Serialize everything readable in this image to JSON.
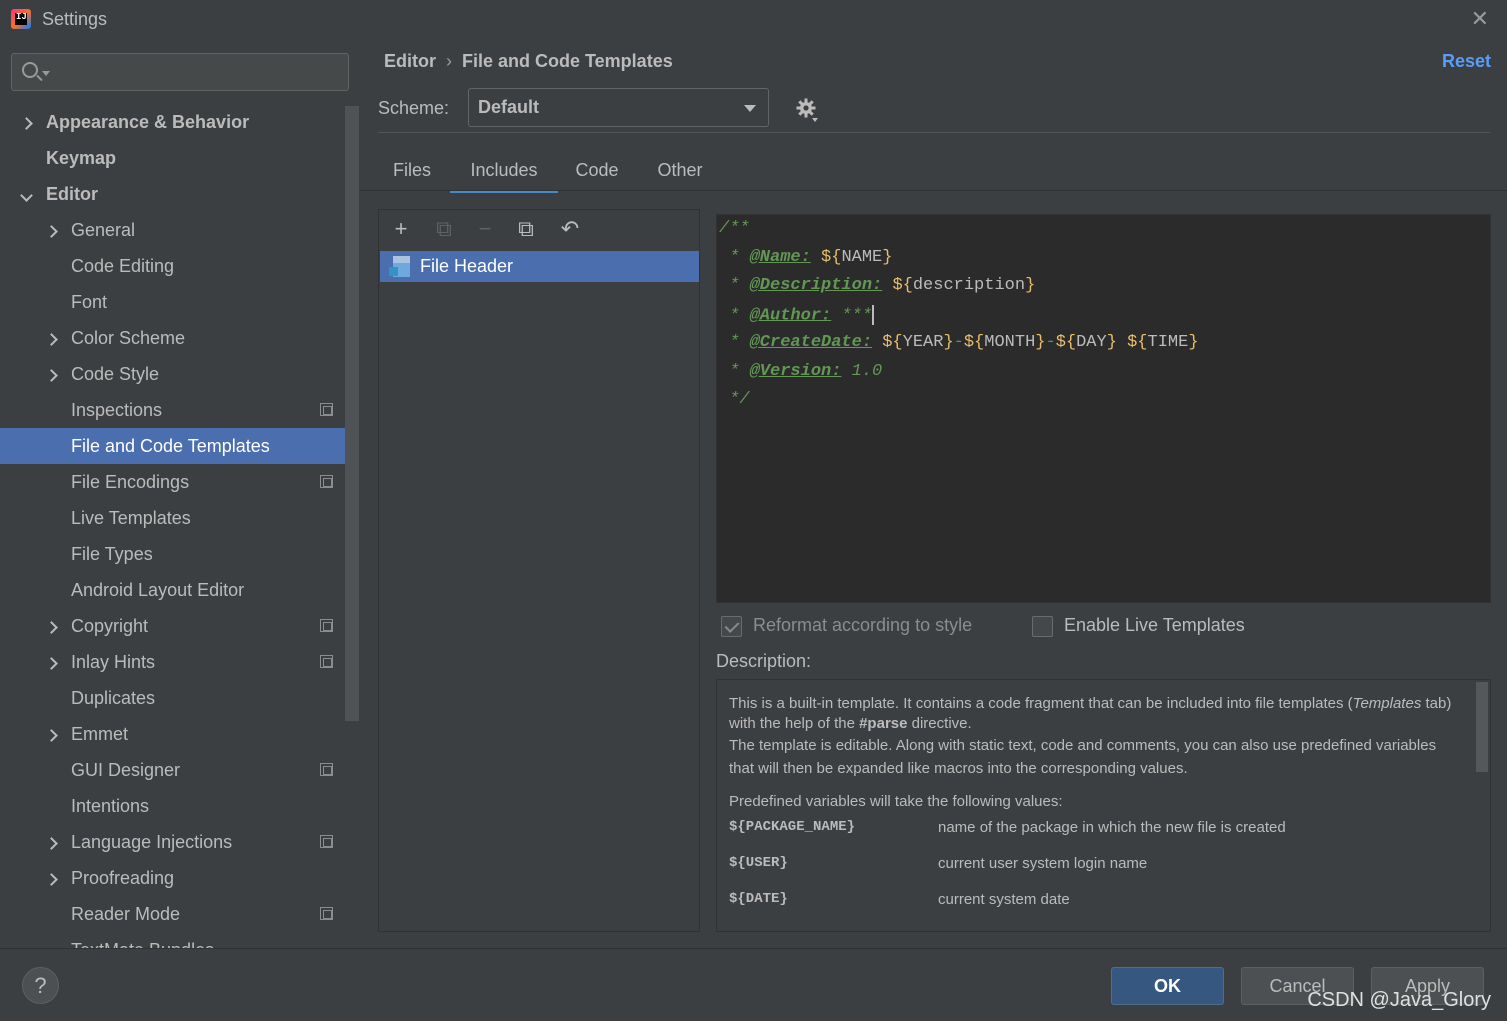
{
  "window": {
    "title": "Settings",
    "close_icon": "close-icon"
  },
  "sidebar": {
    "search_placeholder": "",
    "items": [
      {
        "label": "Appearance & Behavior",
        "level": 0,
        "arrow": "right",
        "project_icon": false,
        "selected": false
      },
      {
        "label": "Keymap",
        "level": 0,
        "arrow": "none",
        "project_icon": false,
        "selected": false
      },
      {
        "label": "Editor",
        "level": 0,
        "arrow": "down",
        "project_icon": false,
        "selected": false
      },
      {
        "label": "General",
        "level": 1,
        "arrow": "right",
        "project_icon": false,
        "selected": false
      },
      {
        "label": "Code Editing",
        "level": 1,
        "arrow": "none",
        "project_icon": false,
        "selected": false
      },
      {
        "label": "Font",
        "level": 1,
        "arrow": "none",
        "project_icon": false,
        "selected": false
      },
      {
        "label": "Color Scheme",
        "level": 1,
        "arrow": "right",
        "project_icon": false,
        "selected": false
      },
      {
        "label": "Code Style",
        "level": 1,
        "arrow": "right",
        "project_icon": false,
        "selected": false
      },
      {
        "label": "Inspections",
        "level": 1,
        "arrow": "none",
        "project_icon": true,
        "selected": false
      },
      {
        "label": "File and Code Templates",
        "level": 1,
        "arrow": "none",
        "project_icon": false,
        "selected": true
      },
      {
        "label": "File Encodings",
        "level": 1,
        "arrow": "none",
        "project_icon": true,
        "selected": false
      },
      {
        "label": "Live Templates",
        "level": 1,
        "arrow": "none",
        "project_icon": false,
        "selected": false
      },
      {
        "label": "File Types",
        "level": 1,
        "arrow": "none",
        "project_icon": false,
        "selected": false
      },
      {
        "label": "Android Layout Editor",
        "level": 1,
        "arrow": "none",
        "project_icon": false,
        "selected": false
      },
      {
        "label": "Copyright",
        "level": 1,
        "arrow": "right",
        "project_icon": true,
        "selected": false
      },
      {
        "label": "Inlay Hints",
        "level": 1,
        "arrow": "right",
        "project_icon": true,
        "selected": false
      },
      {
        "label": "Duplicates",
        "level": 1,
        "arrow": "none",
        "project_icon": false,
        "selected": false
      },
      {
        "label": "Emmet",
        "level": 1,
        "arrow": "right",
        "project_icon": false,
        "selected": false
      },
      {
        "label": "GUI Designer",
        "level": 1,
        "arrow": "none",
        "project_icon": true,
        "selected": false
      },
      {
        "label": "Intentions",
        "level": 1,
        "arrow": "none",
        "project_icon": false,
        "selected": false
      },
      {
        "label": "Language Injections",
        "level": 1,
        "arrow": "right",
        "project_icon": true,
        "selected": false
      },
      {
        "label": "Proofreading",
        "level": 1,
        "arrow": "right",
        "project_icon": false,
        "selected": false
      },
      {
        "label": "Reader Mode",
        "level": 1,
        "arrow": "none",
        "project_icon": true,
        "selected": false
      },
      {
        "label": "TextMate Bundles",
        "level": 1,
        "arrow": "none",
        "project_icon": false,
        "selected": false
      }
    ]
  },
  "header": {
    "breadcrumb": [
      "Editor",
      "File and Code Templates"
    ],
    "reset_label": "Reset"
  },
  "scheme": {
    "label": "Scheme:",
    "value": "Default"
  },
  "tabs": [
    {
      "label": "Files",
      "active": false
    },
    {
      "label": "Includes",
      "active": true
    },
    {
      "label": "Code",
      "active": false
    },
    {
      "label": "Other",
      "active": false
    }
  ],
  "toolbar": {
    "icons": [
      {
        "name": "add-icon",
        "glyph": "+",
        "enabled": true
      },
      {
        "name": "add-child-icon",
        "glyph": "⧉",
        "enabled": false
      },
      {
        "name": "remove-icon",
        "glyph": "−",
        "enabled": false
      },
      {
        "name": "copy-icon",
        "glyph": "⧉",
        "enabled": true
      },
      {
        "name": "revert-icon",
        "glyph": "↶",
        "enabled": true
      }
    ]
  },
  "templates": [
    {
      "label": "File Header",
      "selected": true
    }
  ],
  "editor": {
    "lines": [
      {
        "parts": [
          {
            "t": "/**",
            "c": "com"
          }
        ]
      },
      {
        "parts": [
          {
            "t": " * ",
            "c": "com"
          },
          {
            "t": "@Name:",
            "c": "tag"
          },
          {
            "t": " ",
            "c": "com"
          },
          {
            "t": "${",
            "c": "brace"
          },
          {
            "t": "NAME",
            "c": "var"
          },
          {
            "t": "}",
            "c": "brace"
          }
        ]
      },
      {
        "parts": [
          {
            "t": " * ",
            "c": "com"
          },
          {
            "t": "@Description:",
            "c": "tag"
          },
          {
            "t": " ",
            "c": "com"
          },
          {
            "t": "${",
            "c": "brace"
          },
          {
            "t": "description",
            "c": "var"
          },
          {
            "t": "}",
            "c": "brace"
          }
        ]
      },
      {
        "parts": [
          {
            "t": " * ",
            "c": "com"
          },
          {
            "t": "@Author:",
            "c": "tag"
          },
          {
            "t": " ***",
            "c": "com"
          },
          {
            "t": "",
            "c": "caret"
          }
        ]
      },
      {
        "parts": [
          {
            "t": " * ",
            "c": "com"
          },
          {
            "t": "@CreateDate:",
            "c": "tag"
          },
          {
            "t": " ",
            "c": "com"
          },
          {
            "t": "${",
            "c": "brace"
          },
          {
            "t": "YEAR",
            "c": "var"
          },
          {
            "t": "}",
            "c": "brace"
          },
          {
            "t": "-",
            "c": "com"
          },
          {
            "t": "${",
            "c": "brace"
          },
          {
            "t": "MONTH",
            "c": "var"
          },
          {
            "t": "}",
            "c": "brace"
          },
          {
            "t": "-",
            "c": "com"
          },
          {
            "t": "${",
            "c": "brace"
          },
          {
            "t": "DAY",
            "c": "var"
          },
          {
            "t": "}",
            "c": "brace"
          },
          {
            "t": " ",
            "c": "com"
          },
          {
            "t": "${",
            "c": "brace"
          },
          {
            "t": "TIME",
            "c": "var"
          },
          {
            "t": "}",
            "c": "brace"
          }
        ]
      },
      {
        "parts": [
          {
            "t": " * ",
            "c": "com"
          },
          {
            "t": "@Version:",
            "c": "tag"
          },
          {
            "t": " 1.0",
            "c": "com"
          }
        ]
      },
      {
        "parts": [
          {
            "t": " */",
            "c": "com"
          }
        ]
      }
    ]
  },
  "options": {
    "reformat": {
      "label": "Reformat according to style",
      "checked": true,
      "enabled": false
    },
    "live_templates": {
      "label": "Enable Live Templates",
      "checked": false,
      "enabled": true
    }
  },
  "description": {
    "label": "Description:",
    "para1_a": "This is a built-in template. It contains a code fragment that can be included into file templates (",
    "para1_b": "Templates",
    "para1_c": " tab) with the help of the ",
    "para1_d": "#parse",
    "para1_e": " directive.",
    "para2": "The template is editable. Along with static text, code and comments, you can also use predefined variables that will then be expanded like macros into the corresponding values.",
    "para3": "Predefined variables will take the following values:",
    "variables": [
      {
        "name": "${PACKAGE_NAME}",
        "desc": "name of the package in which the new file is created"
      },
      {
        "name": "${USER}",
        "desc": "current user system login name"
      },
      {
        "name": "${DATE}",
        "desc": "current system date"
      }
    ]
  },
  "buttons": {
    "ok": "OK",
    "cancel": "Cancel",
    "apply": "Apply",
    "help": "?"
  },
  "watermark": "CSDN @Java_Glory"
}
